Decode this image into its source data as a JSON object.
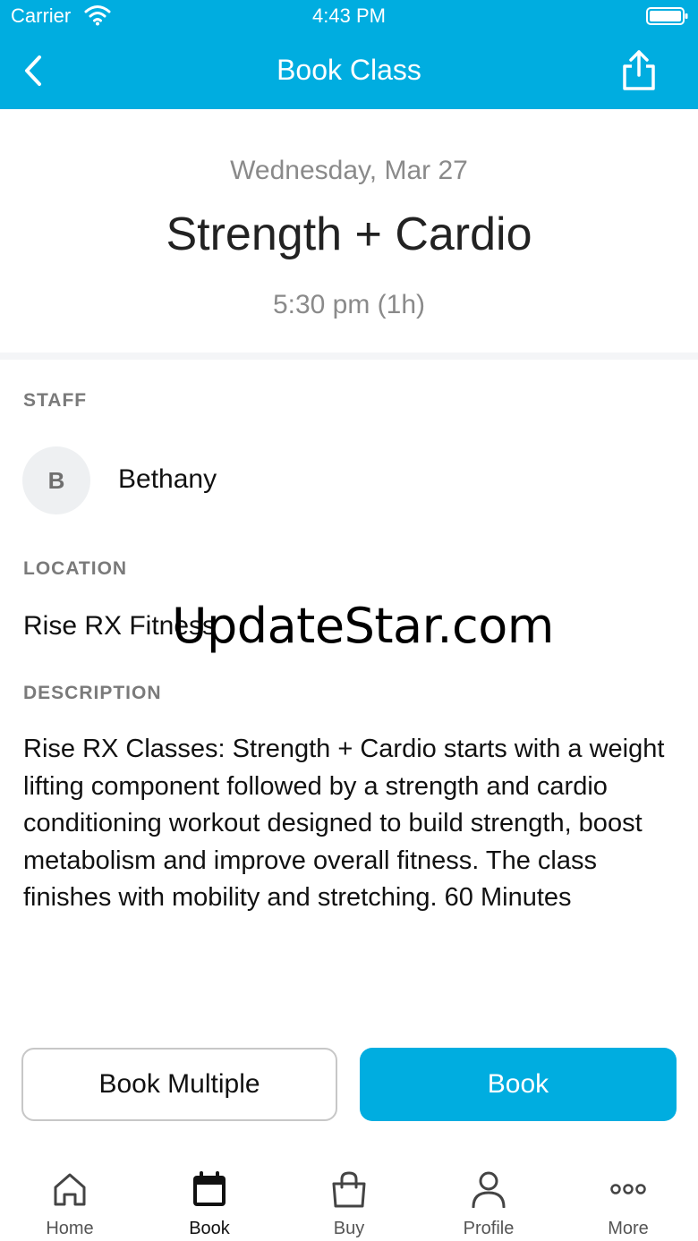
{
  "status_bar": {
    "carrier": "Carrier",
    "time": "4:43 PM"
  },
  "header": {
    "title": "Book Class",
    "back_icon": "chevron-left-icon",
    "share_icon": "share-icon"
  },
  "class": {
    "date": "Wednesday, Mar 27",
    "name": "Strength + Cardio",
    "time": "5:30 pm (1h)"
  },
  "staff": {
    "label": "STAFF",
    "initial": "B",
    "name": "Bethany"
  },
  "location": {
    "label": "LOCATION",
    "name": "Rise RX Fitness"
  },
  "description": {
    "label": "DESCRIPTION",
    "text": "Rise RX Classes: Strength + Cardio starts with a weight lifting component followed by a strength and cardio conditioning workout designed to build strength, boost metabolism and improve overall fitness. The class finishes with mobility and stretching. 60 Minutes"
  },
  "watermark": "UpdateStar.com",
  "actions": {
    "book_multiple": "Book Multiple",
    "book": "Book"
  },
  "tabs": [
    {
      "label": "Home",
      "icon": "home-icon"
    },
    {
      "label": "Book",
      "icon": "calendar-icon",
      "active": true
    },
    {
      "label": "Buy",
      "icon": "shopping-bag-icon"
    },
    {
      "label": "Profile",
      "icon": "person-icon"
    },
    {
      "label": "More",
      "icon": "more-dots-icon"
    }
  ],
  "colors": {
    "accent": "#00ADE0",
    "muted_text": "#8a8a8a",
    "label_text": "#7a7a7a"
  }
}
